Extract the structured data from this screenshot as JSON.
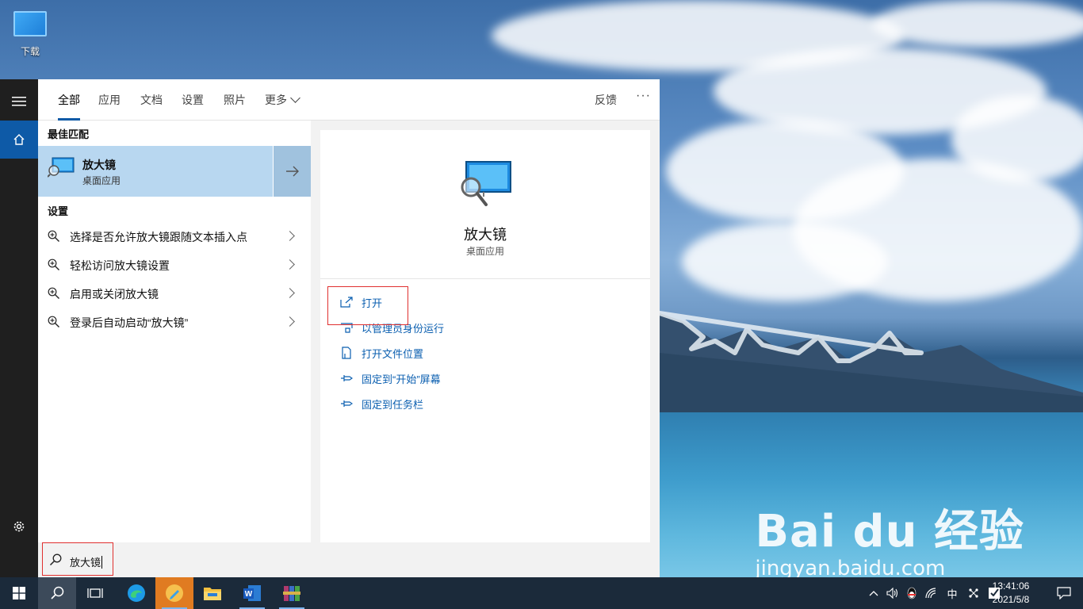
{
  "desktop": {
    "icon_label": "下载",
    "watermark_brand": "Bai du 经验",
    "watermark_url": "jingyan.baidu.com"
  },
  "tabs": {
    "all": "全部",
    "apps": "应用",
    "docs": "文档",
    "settings": "设置",
    "photos": "照片",
    "more": "更多",
    "feedback": "反馈",
    "options": "···"
  },
  "results": {
    "best_match_heading": "最佳匹配",
    "best_match": {
      "name": "放大镜",
      "type": "桌面应用"
    },
    "settings_heading": "设置",
    "settings_items": [
      "选择是否允许放大镜跟随文本插入点",
      "轻松访问放大镜设置",
      "启用或关闭放大镜",
      "登录后自动启动“放大镜”"
    ]
  },
  "detail": {
    "app_name": "放大镜",
    "app_type": "桌面应用",
    "actions": [
      "打开",
      "以管理员身份运行",
      "打开文件位置",
      "固定到“开始”屏幕",
      "固定到任务栏"
    ]
  },
  "search": {
    "value": "放大镜"
  },
  "tray": {
    "ime": "中",
    "time": "13:41:06",
    "date": "2021/5/8"
  },
  "colors": {
    "accent": "#0e5aa7",
    "highlight": "#b8d7f0",
    "annotation": "#e0302f",
    "link": "#0b5fb0"
  }
}
